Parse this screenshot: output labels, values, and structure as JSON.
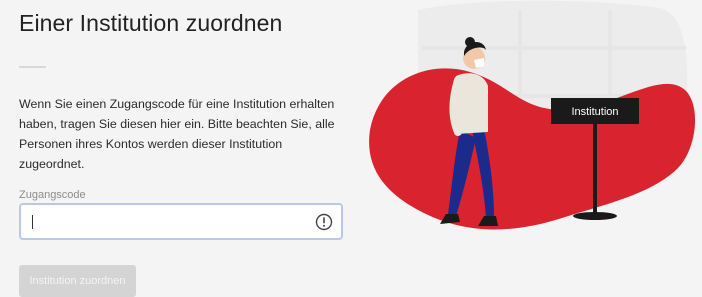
{
  "page": {
    "title": "Einer Institution zuordnen",
    "description": "Wenn Sie einen Zugangscode für eine Institution erhalten haben, tragen Sie diesen hier ein. Bitte beachten Sie, alle Personen ihres Kontos werden dieser Institution zugeordnet."
  },
  "form": {
    "code_label": "Zugangscode",
    "code_value": "",
    "code_placeholder": "",
    "submit_label": "Institution zuordnen"
  },
  "illustration": {
    "sign_label": "Institution"
  },
  "colors": {
    "accent_red": "#d9232f",
    "input_border": "#b9c8ec",
    "button_disabled": "#d4d4d4"
  }
}
